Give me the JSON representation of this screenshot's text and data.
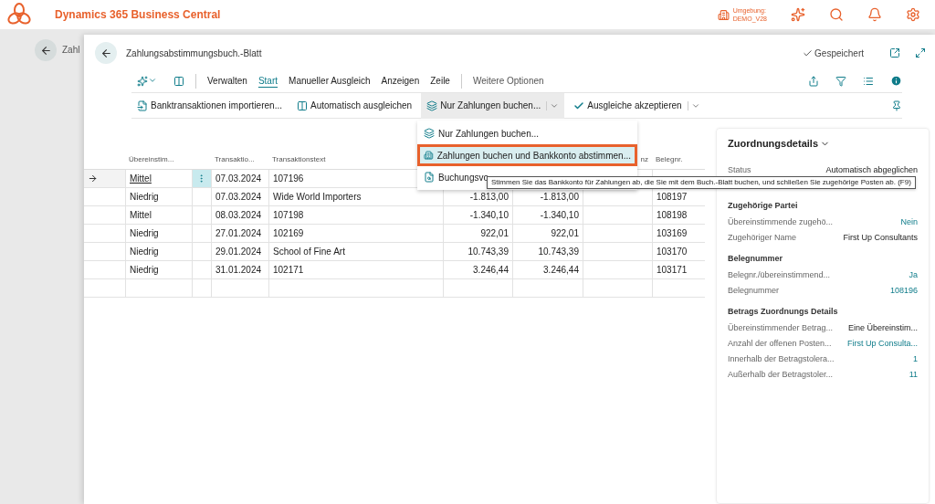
{
  "app_bar": {
    "title": "Dynamics 365 Business Central",
    "environment_label": "Umgebung:",
    "environment": "DEMO_V28"
  },
  "background_page": {
    "title": "Zahl"
  },
  "page": {
    "title": "Zahlungsabstimmungsbuch.-Blatt",
    "save_status": "Gespeichert"
  },
  "tabs": [
    {
      "label": "Verwalten",
      "selected": false
    },
    {
      "label": "Start",
      "selected": true
    },
    {
      "label": "Manueller Ausgleich",
      "selected": false
    },
    {
      "label": "Anzeigen",
      "selected": false
    },
    {
      "label": "Zeile",
      "selected": false
    }
  ],
  "more_options": "Weitere Optionen",
  "actions": [
    {
      "label": "Banktransaktionen importieren...",
      "kind": "import",
      "open": false
    },
    {
      "label": "Automatisch ausgleichen",
      "kind": "match",
      "open": false
    },
    {
      "label": "Nur Zahlungen buchen...",
      "kind": "post",
      "open": true
    },
    {
      "label": "Ausgleiche akzeptieren",
      "kind": "accept",
      "open": false
    }
  ],
  "menu": [
    {
      "label": "Nur Zahlungen buchen...",
      "kind": "post",
      "selected": false
    },
    {
      "label": "Zahlungen buchen und Bankkonto abstimmen...",
      "kind": "reconcile",
      "selected": true
    },
    {
      "label": "Buchungsvo",
      "kind": "preview",
      "selected": false
    }
  ],
  "tooltip": "Stimmen Sie das Bankkonto für Zahlungen ab, die Sie mit dem Buch.-Blatt buchen, und schließen Sie zugehörige Posten ab. (F9)",
  "table": {
    "headers": {
      "match": "Übereinstim...",
      "date": "Transaktio...",
      "text": "Transaktionstext",
      "column_8": "nz",
      "document": "Belegnr."
    },
    "rows": [
      {
        "current": true,
        "match": "Mittel",
        "date": "07.03.2024",
        "text": "107196"
      },
      {
        "current": false,
        "match": "Niedrig",
        "date": "07.03.2024",
        "text": "Wide World Importers",
        "column_6": "-1.813,00",
        "column_7": "-1.813,00",
        "document": "108197"
      },
      {
        "current": false,
        "match": "Mittel",
        "date": "08.03.2024",
        "text": "107198",
        "column_6": "-1.340,10",
        "column_7": "-1.340,10",
        "document": "108198"
      },
      {
        "current": false,
        "match": "Niedrig",
        "date": "27.01.2024",
        "text": "102169",
        "column_6": "922,01",
        "column_7": "922,01",
        "document": "103169"
      },
      {
        "current": false,
        "match": "Niedrig",
        "date": "29.01.2024",
        "text": "School of Fine Art",
        "column_6": "10.743,39",
        "column_7": "10.743,39",
        "document": "103170"
      },
      {
        "current": false,
        "match": "Niedrig",
        "date": "31.01.2024",
        "text": "102171",
        "column_6": "3.246,44",
        "column_7": "3.246,44",
        "document": "103171"
      }
    ]
  },
  "details": {
    "title": "Zuordnungsdetails",
    "sections": [
      {
        "rows": [
          {
            "label": "Status",
            "value": "Automatisch abgeglichen",
            "kind": "text"
          }
        ]
      },
      {
        "title": "Zugehörige Partei",
        "rows": [
          {
            "label": "Übereinstimmende zugehö...",
            "value": "Nein",
            "kind": "link"
          },
          {
            "label": "Zugehöriger Name",
            "value": "First Up Consultants",
            "kind": "text"
          }
        ]
      },
      {
        "title": "Belegnummer",
        "rows": [
          {
            "label": "Belegnr./übereinstimmend...",
            "value": "Ja",
            "kind": "link"
          },
          {
            "label": "Belegnummer",
            "value": "108196",
            "kind": "link"
          }
        ]
      },
      {
        "title": "Betrags Zuordnungs Details",
        "rows": [
          {
            "label": "Übereinstimmender Betrag...",
            "value": "Eine Übereinstim...",
            "kind": "text"
          },
          {
            "label": "Anzahl der offenen Posten...",
            "value": "First Up Consulta...",
            "kind": "link"
          },
          {
            "label": "Innerhalb der Betragstolera...",
            "value": "1",
            "kind": "link"
          },
          {
            "label": "Außerhalb der Betragstoler...",
            "value": "11",
            "kind": "link"
          }
        ]
      }
    ]
  }
}
